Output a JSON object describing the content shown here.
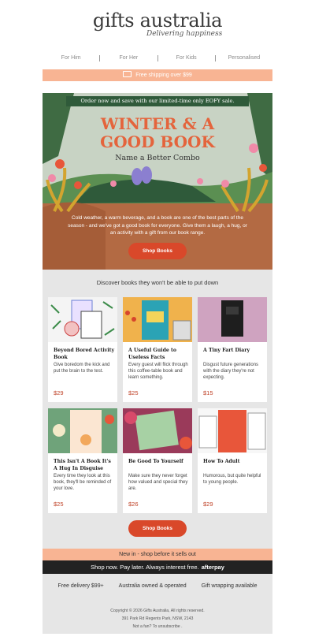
{
  "brand": {
    "name": "gifts australia",
    "tagline": "Delivering happiness"
  },
  "nav": [
    "For Him",
    "For Her",
    "For Kids",
    "Personalised"
  ],
  "shipping_bar": {
    "icon": "truck-icon",
    "text": "Free shipping over $99"
  },
  "hero": {
    "banner": "Order now and save with our limited-time only EOFY sale.",
    "title_line1": "WINTER & A",
    "title_line2": "GOOD BOOK",
    "subtitle": "Name a Better Combo",
    "body": "Cold weather, a warm beverage, and a book are one of the best parts of the season - and we've got a good book for everyone. Give them a laugh, a hug, or an activity with a gift from our book range.",
    "button": "Shop Books"
  },
  "products": {
    "heading": "Discover books they won't be able to put down",
    "items": [
      {
        "title": "Beyond Bored Activity Book",
        "desc": "Give boredom the kick and put the brain to the test.",
        "price": "$29"
      },
      {
        "title": "A Useful Guide to Useless Facts",
        "desc": "Every guest will flick through this coffee-table book and learn something.",
        "price": "$25"
      },
      {
        "title": "A Tiny Fart Diary",
        "desc": "Disgust future generations with the diary they're not expecting.",
        "price": "$15"
      },
      {
        "title": "This Isn't A Book It's A Hug In Disguise",
        "desc": "Every time they look at this book, they'll be reminded of your love.",
        "price": "$25"
      },
      {
        "title": "Be Good To Yourself",
        "desc": "Make sure they never forget how valued and special they are.",
        "price": "$26"
      },
      {
        "title": "How To Adult",
        "desc": "Humorous, but quite helpful to young people.",
        "price": "$29"
      }
    ],
    "button": "Shop Books"
  },
  "new_in_bar": "New in - shop before it sells out",
  "afterpay_bar": {
    "text": "Shop now. Pay later. Always interest free.",
    "logo": "afterpay"
  },
  "footer": {
    "usps": [
      "Free delivery $99+",
      "Australia owned & operated",
      "Gift wrapping available"
    ],
    "copyright": "Copyright © 2026 Gifts Australia, All rights reserved.",
    "address": "391 Park Rd Regents Park, NSW, 2143",
    "unsubscribe": "Not a fan? To unsubscribe ."
  },
  "colors": {
    "accent": "#d9482a",
    "peach": "#f8b493",
    "price": "#c0442a",
    "banner_green": "#2f5a3a"
  }
}
